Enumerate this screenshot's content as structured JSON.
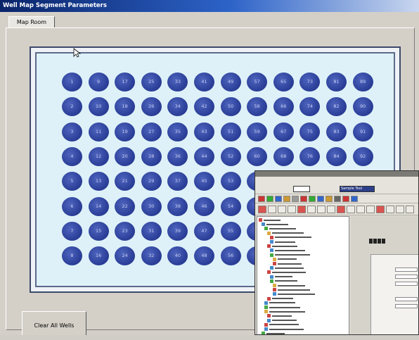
{
  "window": {
    "title": "Well Map Segment Parameters",
    "tab_label": "Map Room",
    "clear_button_label": "Clear All Wells"
  },
  "plate": {
    "rows": 8,
    "cols": 12,
    "well_color": "#2b3f99",
    "well_label_color": "#c7cff2",
    "wells": [
      [
        "1",
        "9",
        "17",
        "25",
        "33",
        "41",
        "49",
        "57",
        "65",
        "73",
        "81",
        "89"
      ],
      [
        "2",
        "10",
        "18",
        "26",
        "34",
        "42",
        "50",
        "58",
        "66",
        "74",
        "82",
        "90"
      ],
      [
        "3",
        "11",
        "19",
        "27",
        "35",
        "43",
        "51",
        "59",
        "67",
        "75",
        "83",
        "91"
      ],
      [
        "4",
        "12",
        "20",
        "28",
        "36",
        "44",
        "52",
        "60",
        "68",
        "76",
        "84",
        "92"
      ],
      [
        "5",
        "13",
        "21",
        "29",
        "37",
        "45",
        "53",
        "",
        "",
        "",
        "",
        ""
      ],
      [
        "6",
        "14",
        "22",
        "30",
        "38",
        "46",
        "54",
        "",
        "",
        "",
        "",
        ""
      ],
      [
        "7",
        "15",
        "23",
        "31",
        "39",
        "47",
        "55",
        "",
        "",
        "",
        "",
        ""
      ],
      [
        "8",
        "16",
        "24",
        "32",
        "40",
        "48",
        "56",
        "",
        "",
        "",
        "",
        ""
      ]
    ]
  },
  "overlay_window": {
    "toolbar_dropdown": "Sample Tool",
    "icons": [
      "save-icon",
      "open-icon",
      "print-icon",
      "cut-icon",
      "copy-icon",
      "paste-icon",
      "undo-icon",
      "redo-icon",
      "zoom-icon",
      "run-icon",
      "stop-icon",
      "help-icon"
    ]
  }
}
